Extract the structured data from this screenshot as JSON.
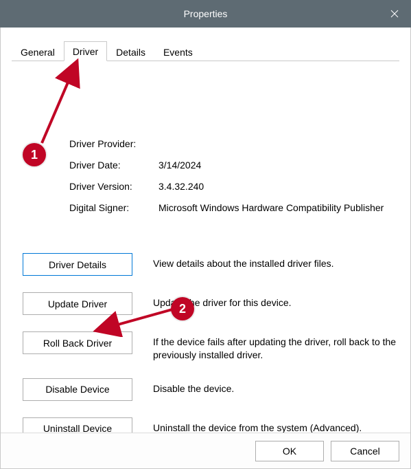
{
  "titlebar": {
    "title": "Properties"
  },
  "tabs": [
    {
      "label": "General",
      "active": false
    },
    {
      "label": "Driver",
      "active": true
    },
    {
      "label": "Details",
      "active": false
    },
    {
      "label": "Events",
      "active": false
    }
  ],
  "info": {
    "provider_label": "Driver Provider:",
    "provider_value": "",
    "date_label": "Driver Date:",
    "date_value": "3/14/2024",
    "version_label": "Driver Version:",
    "version_value": "3.4.32.240",
    "signer_label": "Digital Signer:",
    "signer_value": "Microsoft Windows Hardware Compatibility Publisher"
  },
  "actions": {
    "details": {
      "button": "Driver Details",
      "desc": "View details about the installed driver files."
    },
    "update": {
      "button": "Update Driver",
      "desc": "Update the driver for this device."
    },
    "rollback": {
      "button": "Roll Back Driver",
      "desc": "If the device fails after updating the driver, roll back to the previously installed driver."
    },
    "disable": {
      "button": "Disable Device",
      "desc": "Disable the device."
    },
    "uninstall": {
      "button": "Uninstall Device",
      "desc": "Uninstall the device from the system (Advanced)."
    }
  },
  "footer": {
    "ok": "OK",
    "cancel": "Cancel"
  },
  "annotations": {
    "step1": "1",
    "step2": "2"
  }
}
